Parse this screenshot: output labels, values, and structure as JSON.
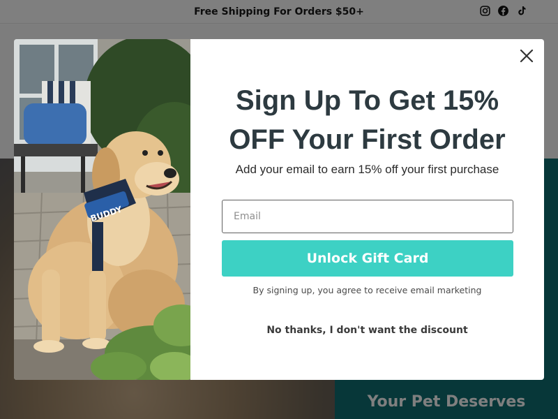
{
  "announcement": {
    "text": "Free Shipping For Orders $50+"
  },
  "social": [
    "instagram-icon",
    "facebook-icon",
    "tiktok-icon"
  ],
  "background": {
    "section_title": "Your Pet Deserves"
  },
  "popup": {
    "headline_line1": "Sign Up To Get 15%",
    "headline_line2": "OFF Your First Order",
    "subheadline": "Add your email to earn 15% off your first purchase",
    "email_placeholder": "Email",
    "email_value": "",
    "submit_label": "Unlock Gift Card",
    "disclaimer": "By signing up, you agree to receive email marketing",
    "decline_label": "No thanks, I don't want the discount",
    "harness_label": "BUDDY"
  },
  "colors": {
    "accent": "#3dd1c4",
    "teal_section": "#0f6f73",
    "headline": "#2d3a40"
  }
}
